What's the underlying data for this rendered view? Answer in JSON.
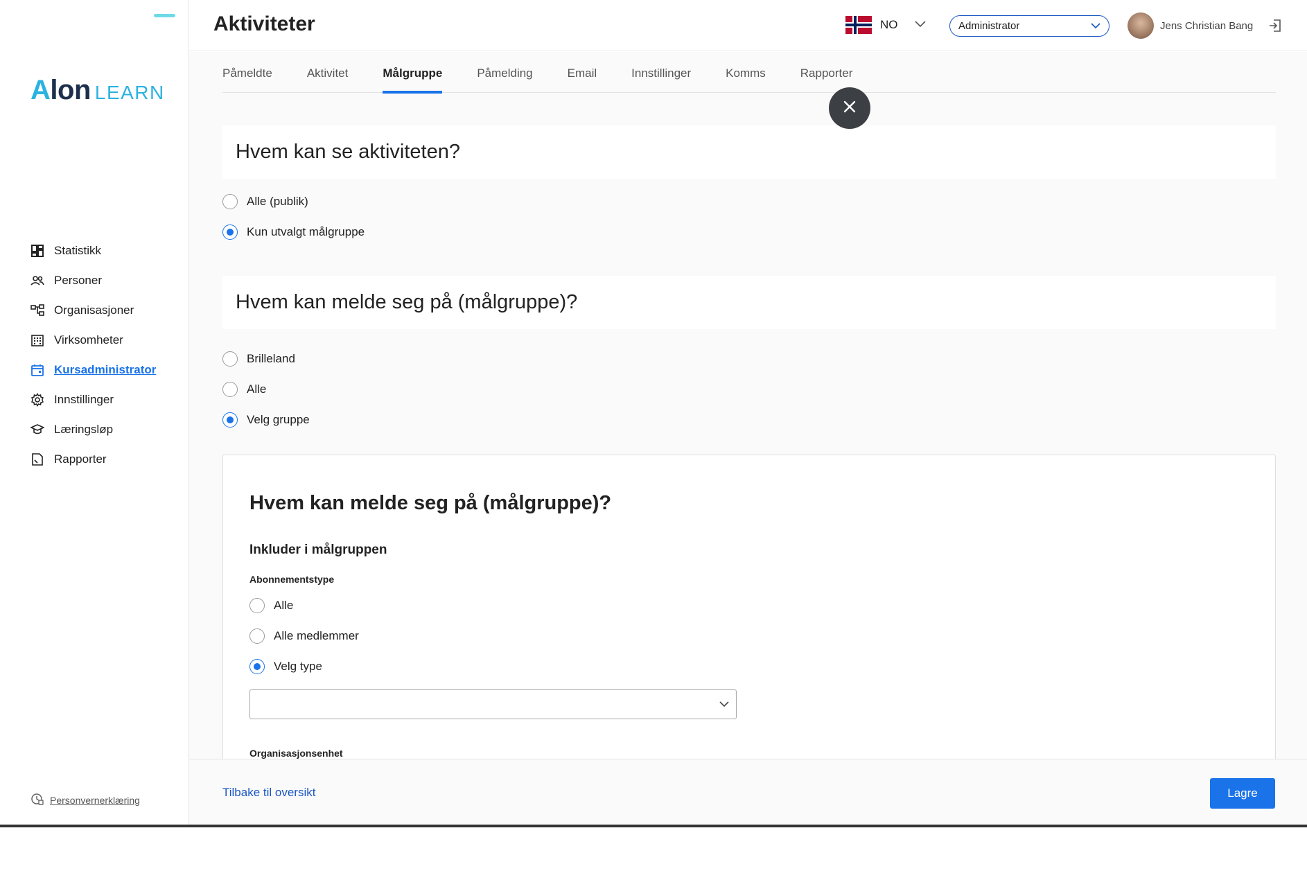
{
  "app": {
    "logo_text": "Alon",
    "logo_sub": "LEARN"
  },
  "header": {
    "title": "Aktiviteter",
    "language_code": "NO",
    "role_selected": "Administrator",
    "user_name": "Jens Christian Bang"
  },
  "sidebar": {
    "items": [
      {
        "label": "Statistikk",
        "icon": "dashboard-icon"
      },
      {
        "label": "Personer",
        "icon": "people-icon"
      },
      {
        "label": "Organisasjoner",
        "icon": "hierarchy-icon"
      },
      {
        "label": "Virksomheter",
        "icon": "building-icon"
      },
      {
        "label": "Kursadministrator",
        "icon": "calendar-icon",
        "active": true
      },
      {
        "label": "Innstillinger",
        "icon": "gear-icon"
      },
      {
        "label": "Læringsløp",
        "icon": "graduation-cap-icon"
      },
      {
        "label": "Rapporter",
        "icon": "report-icon"
      }
    ],
    "privacy_label": "Personvernerklæring"
  },
  "tabs": [
    {
      "label": "Påmeldte"
    },
    {
      "label": "Aktivitet"
    },
    {
      "label": "Målgruppe",
      "active": true
    },
    {
      "label": "Påmelding"
    },
    {
      "label": "Email"
    },
    {
      "label": "Innstillinger"
    },
    {
      "label": "Komms"
    },
    {
      "label": "Rapporter"
    }
  ],
  "visibility": {
    "heading": "Hvem kan se aktiviteten?",
    "options": [
      {
        "label": "Alle (publik)",
        "checked": false
      },
      {
        "label": "Kun utvalgt målgruppe",
        "checked": true
      }
    ]
  },
  "enrollment": {
    "heading": "Hvem kan melde seg på (målgruppe)?",
    "options": [
      {
        "label": "Brilleland",
        "checked": false
      },
      {
        "label": "Alle",
        "checked": false
      },
      {
        "label": "Velg gruppe",
        "checked": true
      }
    ]
  },
  "group_card": {
    "title": "Hvem kan melde seg på (målgruppe)?",
    "subtitle": "Inkluder i målgruppen",
    "subscription_label": "Abonnementstype",
    "subscription_options": [
      {
        "label": "Alle",
        "checked": false
      },
      {
        "label": "Alle medlemmer",
        "checked": false
      },
      {
        "label": "Velg type",
        "checked": true
      }
    ],
    "type_select_value": "",
    "org_unit_label": "Organisasjonsenhet"
  },
  "footer": {
    "back_label": "Tilbake til oversikt",
    "save_label": "Lagre"
  },
  "colors": {
    "accent": "#1a73e8",
    "logo_cyan": "#2bb3e0",
    "fab": "#3c3f44"
  }
}
